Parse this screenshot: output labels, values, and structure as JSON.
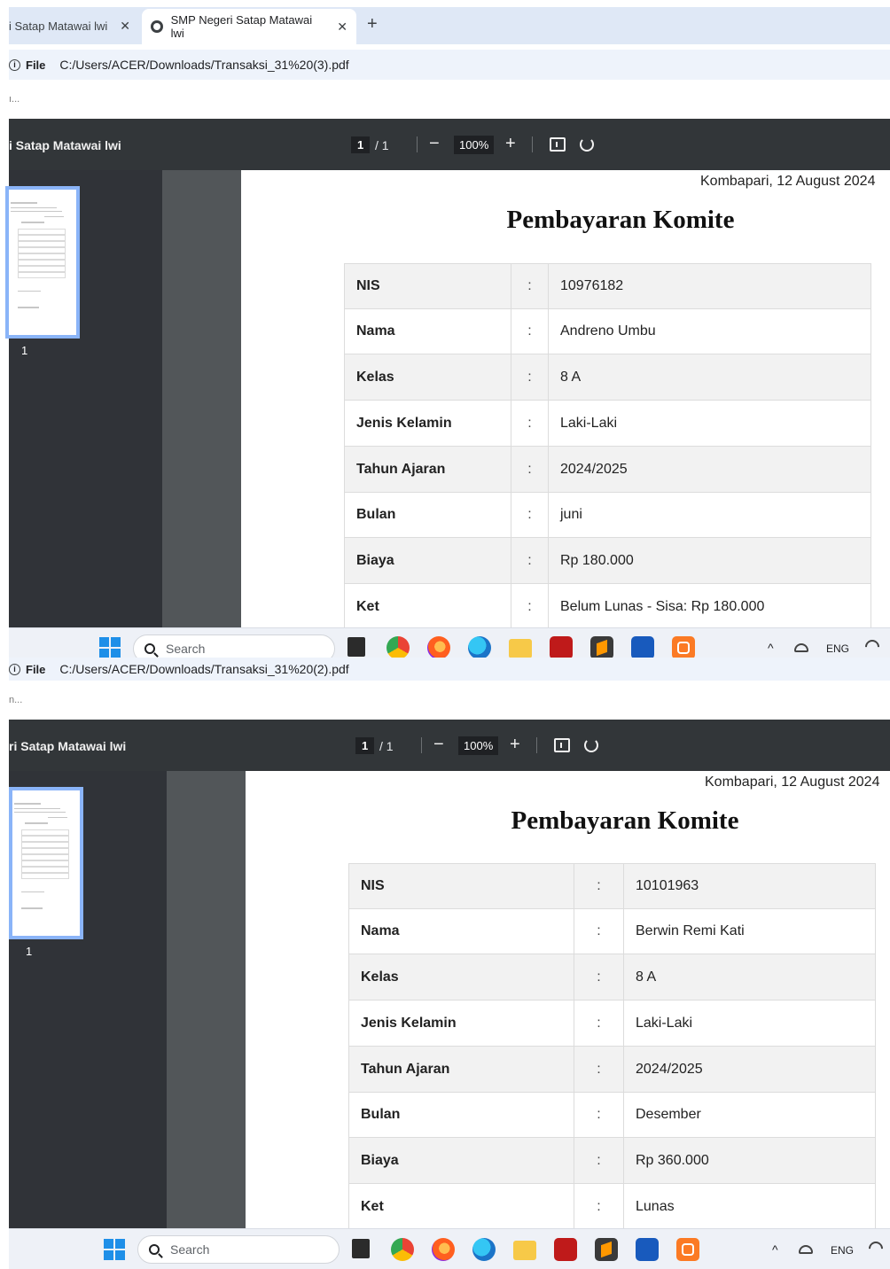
{
  "windows": [
    {
      "tab_inactive_label": "i Satap Matawai lwi",
      "tab_active_label": "SMP Negeri Satap Matawai lwi",
      "tab_close": "✕",
      "new_tab": "+",
      "address_scheme": "File",
      "address_path": "C:/Users/ACER/Downloads/Transaksi_31%20(3).pdf",
      "hint_text": "ı...",
      "pdf_title": "i Satap Matawai lwi",
      "page_current": "1",
      "page_total": "/ 1",
      "zoom": "100%",
      "zoom_out": "−",
      "zoom_in": "+",
      "thumb_page_num": "1",
      "date": "Kombapari, 12 August 2024",
      "title": "Pembayaran Komite",
      "rows": [
        {
          "label": "NIS",
          "colon": ":",
          "value": "10976182"
        },
        {
          "label": "Nama",
          "colon": ":",
          "value": "Andreno Umbu"
        },
        {
          "label": "Kelas",
          "colon": ":",
          "value": "8 A"
        },
        {
          "label": "Jenis Kelamin",
          "colon": ":",
          "value": "Laki-Laki"
        },
        {
          "label": "Tahun Ajaran",
          "colon": ":",
          "value": "2024/2025"
        },
        {
          "label": "Bulan",
          "colon": ":",
          "value": "juni"
        },
        {
          "label": "Biaya",
          "colon": ":",
          "value": "Rp 180.000"
        },
        {
          "label": "Ket",
          "colon": ":",
          "value": "Belum Lunas - Sisa: Rp 180.000"
        }
      ],
      "taskbar": {
        "search": "Search",
        "lang": "ENG"
      }
    },
    {
      "address_scheme": "File",
      "address_path": "C:/Users/ACER/Downloads/Transaksi_31%20(2).pdf",
      "hint_text": "n...",
      "pdf_title": "ri Satap Matawai lwi",
      "page_current": "1",
      "page_total": "/ 1",
      "zoom": "100%",
      "zoom_out": "−",
      "zoom_in": "+",
      "thumb_page_num": "1",
      "date": "Kombapari, 12 August 2024",
      "title": "Pembayaran Komite",
      "rows": [
        {
          "label": "NIS",
          "colon": ":",
          "value": "10101963"
        },
        {
          "label": "Nama",
          "colon": ":",
          "value": "Berwin Remi Kati"
        },
        {
          "label": "Kelas",
          "colon": ":",
          "value": "8 A"
        },
        {
          "label": "Jenis Kelamin",
          "colon": ":",
          "value": "Laki-Laki"
        },
        {
          "label": "Tahun Ajaran",
          "colon": ":",
          "value": "2024/2025"
        },
        {
          "label": "Bulan",
          "colon": ":",
          "value": "Desember"
        },
        {
          "label": "Biaya",
          "colon": ":",
          "value": "Rp 360.000"
        },
        {
          "label": "Ket",
          "colon": ":",
          "value": "Lunas"
        }
      ],
      "taskbar": {
        "search": "Search",
        "lang": "ENG"
      }
    }
  ],
  "icons": {
    "taskbar_apps": [
      "file-explorer-dark-icon",
      "chrome-icon",
      "firefox-icon",
      "edge-icon",
      "folder-icon",
      "filezilla-icon",
      "sublime-icon",
      "word-icon",
      "xampp-icon"
    ]
  },
  "colors": {
    "pdf_toolbar": "#323639",
    "pdf_sidebar": "#303338",
    "thumb_border": "#8ab4f8",
    "tabstrip": "#dfe8f6"
  }
}
